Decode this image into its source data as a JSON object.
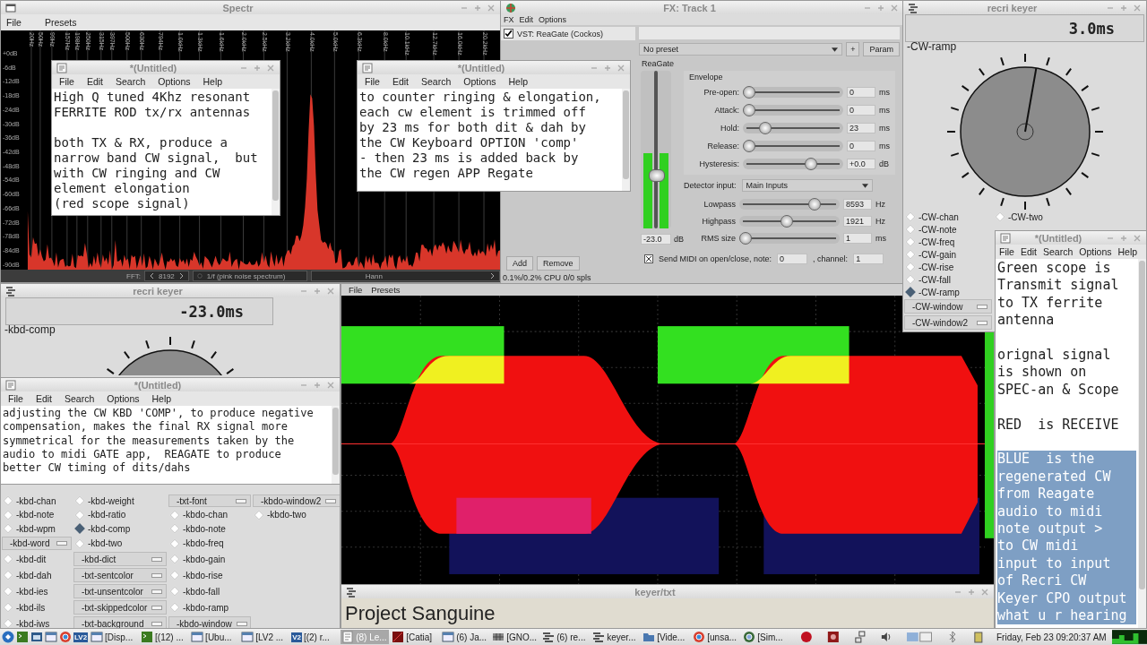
{
  "spectr": {
    "title": "Spectr",
    "menu": [
      "File",
      "Presets"
    ],
    "freq_labels": [
      "20Hz",
      "50Hz",
      "99Hz",
      "157Hz",
      "198Hz",
      "250Hz",
      "315Hz",
      "397Hz",
      "500Hz",
      "630Hz",
      "794Hz",
      "1.0kHz",
      "1.3kHz",
      "1.6kHz",
      "2.0kHz",
      "2.5kHz",
      "3.2kHz",
      "4.0kHz",
      "5.0kHz",
      "6.3kHz",
      "8.0kHz",
      "10.1kHz",
      "12.7kHz",
      "16.0kHz",
      "20.2kHz"
    ],
    "db_labels": [
      "+0dB",
      "-6dB",
      "-12dB",
      "-18dB",
      "-24dB",
      "-30dB",
      "-36dB",
      "-42dB",
      "-48dB",
      "-54dB",
      "-60dB",
      "-66dB",
      "-72dB",
      "-78dB",
      "-84dB",
      "-90dB"
    ],
    "fft_label": "FFT:",
    "fft_size": "8192",
    "weighting": "1/f (pink noise spectrum)",
    "window_fn": "Hann"
  },
  "fx": {
    "title": "FX: Track 1",
    "menu": [
      "FX",
      "Edit",
      "Options"
    ],
    "plugin": {
      "label": "VST: ReaGate (Cockos)",
      "checked": true
    },
    "preset": "No preset",
    "add_preset": "+",
    "param": "Param",
    "plugin_name": "ReaGate",
    "envelope_title": "Envelope",
    "envelope": [
      {
        "label": "Pre-open:",
        "level": 0,
        "value": "0",
        "unit": "ms"
      },
      {
        "label": "Attack:",
        "level": 0,
        "value": "0",
        "unit": "ms"
      },
      {
        "label": "Hold:",
        "level": 0.18,
        "value": "23",
        "unit": "ms"
      },
      {
        "label": "Release:",
        "level": 0,
        "value": "0",
        "unit": "ms"
      },
      {
        "label": "Hysteresis:",
        "level": 0.7,
        "value": "+0.0",
        "unit": "dB"
      }
    ],
    "detector_label": "Detector input:",
    "detector": "Main Inputs",
    "filters": [
      {
        "label": "Lowpass",
        "level": 0.78,
        "value": "8593",
        "unit": "Hz"
      },
      {
        "label": "Highpass",
        "level": 0.47,
        "value": "1921",
        "unit": "Hz"
      },
      {
        "label": "RMS size",
        "level": 0,
        "value": "1",
        "unit": "ms"
      }
    ],
    "threshold": {
      "level": 0.32
    },
    "meter": {
      "level": 0.48
    },
    "gain_value": "-23.0",
    "gain_unit": "dB",
    "send_midi": {
      "label": "Send MIDI on open/close, note:",
      "checked": true
    },
    "note_value": "0",
    "channel_label": ", channel:",
    "channel_value": "1",
    "add": "Add",
    "remove": "Remove",
    "cpu": "0.1%/0.2% CPU 0/0 spls"
  },
  "keyers": [
    {
      "title": "recri keyer",
      "readout": "3.0ms",
      "label": "-CW-ramp",
      "columns": [
        [
          {
            "kind": "radio",
            "label": "-CW-chan",
            "selected": false
          },
          {
            "kind": "radio",
            "label": "-CW-note",
            "selected": false
          },
          {
            "kind": "radio",
            "label": "-CW-freq",
            "selected": false
          },
          {
            "kind": "radio",
            "label": "-CW-gain",
            "selected": false
          },
          {
            "kind": "radio",
            "label": "-CW-rise",
            "selected": false
          },
          {
            "kind": "radio",
            "label": "-CW-fall",
            "selected": false
          },
          {
            "kind": "radio",
            "label": "-CW-ramp",
            "selected": true
          },
          {
            "kind": "menu",
            "label": "-CW-window"
          },
          {
            "kind": "menu",
            "label": "-CW-window2"
          }
        ],
        [
          {
            "kind": "radio",
            "label": "-CW-two",
            "selected": false
          }
        ]
      ]
    },
    {
      "title": "recri keyer",
      "readout": "-23.0ms",
      "label": "-kbd-comp",
      "columns": [
        [
          {
            "kind": "radio",
            "label": "-kbd-chan",
            "selected": false
          },
          {
            "kind": "radio",
            "label": "-kbd-note",
            "selected": false
          },
          {
            "kind": "radio",
            "label": "-kbd-wpm",
            "selected": false
          },
          {
            "kind": "menu",
            "label": "-kbd-word"
          },
          {
            "kind": "radio",
            "label": "-kbd-dit",
            "selected": false
          },
          {
            "kind": "radio",
            "label": "-kbd-dah",
            "selected": false
          },
          {
            "kind": "radio",
            "label": "-kbd-ies",
            "selected": false
          },
          {
            "kind": "radio",
            "label": "-kbd-ils",
            "selected": false
          },
          {
            "kind": "radio",
            "label": "-kbd-iws",
            "selected": false
          }
        ],
        [
          {
            "kind": "radio",
            "label": "-kbd-weight",
            "selected": false
          },
          {
            "kind": "radio",
            "label": "-kbd-ratio",
            "selected": false
          },
          {
            "kind": "radio",
            "label": "-kbd-comp",
            "selected": true
          },
          {
            "kind": "radio",
            "label": "-kbd-two",
            "selected": false
          },
          {
            "kind": "menu",
            "label": "-kbd-dict"
          },
          {
            "kind": "menu",
            "label": "-txt-sentcolor"
          },
          {
            "kind": "menu",
            "label": "-txt-unsentcolor"
          },
          {
            "kind": "menu",
            "label": "-txt-skippedcolor"
          },
          {
            "kind": "menu",
            "label": "-txt-background"
          }
        ],
        [
          {
            "kind": "menu",
            "label": "-txt-font"
          },
          {
            "kind": "radio",
            "label": "-kbdo-chan",
            "selected": false
          },
          {
            "kind": "radio",
            "label": "-kbdo-note",
            "selected": false
          },
          {
            "kind": "radio",
            "label": "-kbdo-freq",
            "selected": false
          },
          {
            "kind": "radio",
            "label": "-kbdo-gain",
            "selected": false
          },
          {
            "kind": "radio",
            "label": "-kbdo-rise",
            "selected": false
          },
          {
            "kind": "radio",
            "label": "-kbdo-fall",
            "selected": false
          },
          {
            "kind": "radio",
            "label": "-kbdo-ramp",
            "selected": false
          },
          {
            "kind": "menu",
            "label": "-kbdo-window"
          }
        ],
        [
          {
            "kind": "menu",
            "label": "-kbdo-window2"
          },
          {
            "kind": "radio",
            "label": "-kbdo-two",
            "selected": false
          }
        ]
      ]
    }
  ],
  "notes": [
    {
      "title": "*(Untitled)",
      "menu": [
        "File",
        "Edit",
        "Search",
        "Options",
        "Help"
      ],
      "paragraphs": [
        {
          "lines": [
            "High Q tuned 4Khz resonant",
            "FERRITE ROD tx/rx antennas"
          ],
          "selected": false
        },
        {
          "lines": [
            "both TX & RX, produce a",
            "narrow band CW signal,  but",
            "with CW ringing and CW",
            "element elongation",
            "(red scope signal)"
          ],
          "selected": false
        }
      ]
    },
    {
      "title": "*(Untitled)",
      "menu": [
        "File",
        "Edit",
        "Search",
        "Options",
        "Help"
      ],
      "paragraphs": [
        {
          "lines": [
            "to counter ringing & elongation,",
            "each cw element is trimmed off",
            "by 23 ms for both dit & dah by",
            "the CW Keyboard OPTION 'comp'",
            "- then 23 ms is added back by",
            "the CW regen APP Regate"
          ],
          "selected": false
        }
      ]
    },
    {
      "title": "*(Untitled)",
      "menu": [
        "File",
        "Edit",
        "Search",
        "Options",
        "Help"
      ],
      "paragraphs": [
        {
          "lines": [
            "adjusting the CW KBD 'COMP', to produce negative",
            "compensation, makes the final RX signal more",
            "symmetrical for the measurements taken by the",
            "audio to midi GATE app,  REAGATE to produce",
            "better CW timing of dits/dahs"
          ],
          "selected": false
        }
      ]
    },
    {
      "title": "*(Untitled)",
      "menu": [
        "File",
        "Edit",
        "Search",
        "Options",
        "Help"
      ],
      "paragraphs": [
        {
          "lines": [
            "Green scope is",
            "Transmit signal",
            "to TX ferrite",
            "antenna"
          ],
          "selected": false
        },
        {
          "lines": [
            "orignal signal",
            "is shown on",
            "SPEC-an & Scope"
          ],
          "selected": false
        },
        {
          "lines": [
            "RED  is RECEIVE"
          ],
          "selected": false
        },
        {
          "lines": [
            "BLUE  is the",
            "regenerated CW",
            "from Reagate",
            "audio to midi",
            "note output >",
            "to CW midi",
            "input to input",
            "of Recri CW",
            "Keyer CPO output",
            "what u r hearing"
          ],
          "selected": true
        }
      ]
    }
  ],
  "scope": {
    "menu": [
      "File",
      "Presets"
    ]
  },
  "keyer_txt": {
    "title": "keyer/txt",
    "text": "Project Sanguine"
  },
  "taskbar": {
    "launchers": [
      {
        "kind": "start"
      },
      {
        "kind": "terminal"
      },
      {
        "kind": "files"
      },
      {
        "kind": "window"
      },
      {
        "kind": "browser"
      },
      {
        "kind": "badge",
        "badge": "LV2"
      }
    ],
    "tasks": [
      {
        "kind": "monitor",
        "label": "[Disp...",
        "selected": false
      },
      {
        "kind": "terminal",
        "label": "[(12) ...",
        "selected": false
      },
      {
        "kind": "window",
        "label": "[Ubu...",
        "selected": false
      },
      {
        "kind": "window",
        "label": "[LV2 ...",
        "selected": false
      },
      {
        "kind": "badge",
        "badge": "V2",
        "label": "[(2) r...",
        "selected": false
      },
      {
        "kind": "notepad",
        "label": "(8) Le...",
        "selected": true
      },
      {
        "kind": "catia",
        "label": "[Catia]",
        "selected": false
      },
      {
        "kind": "window",
        "label": "(6) Ja...",
        "selected": false
      },
      {
        "kind": "gnome",
        "label": "[GNO...",
        "selected": false
      },
      {
        "kind": "keyer",
        "label": "(6) re...",
        "selected": false
      },
      {
        "kind": "keyer",
        "label": "keyer...",
        "selected": false
      },
      {
        "kind": "folder",
        "label": "[Vide...",
        "selected": false
      },
      {
        "kind": "reaper",
        "label": "[unsa...",
        "selected": false
      },
      {
        "kind": "globe",
        "label": "[Sim...",
        "selected": false
      }
    ],
    "clock": "Friday, Feb 23 09:20:37 AM"
  }
}
